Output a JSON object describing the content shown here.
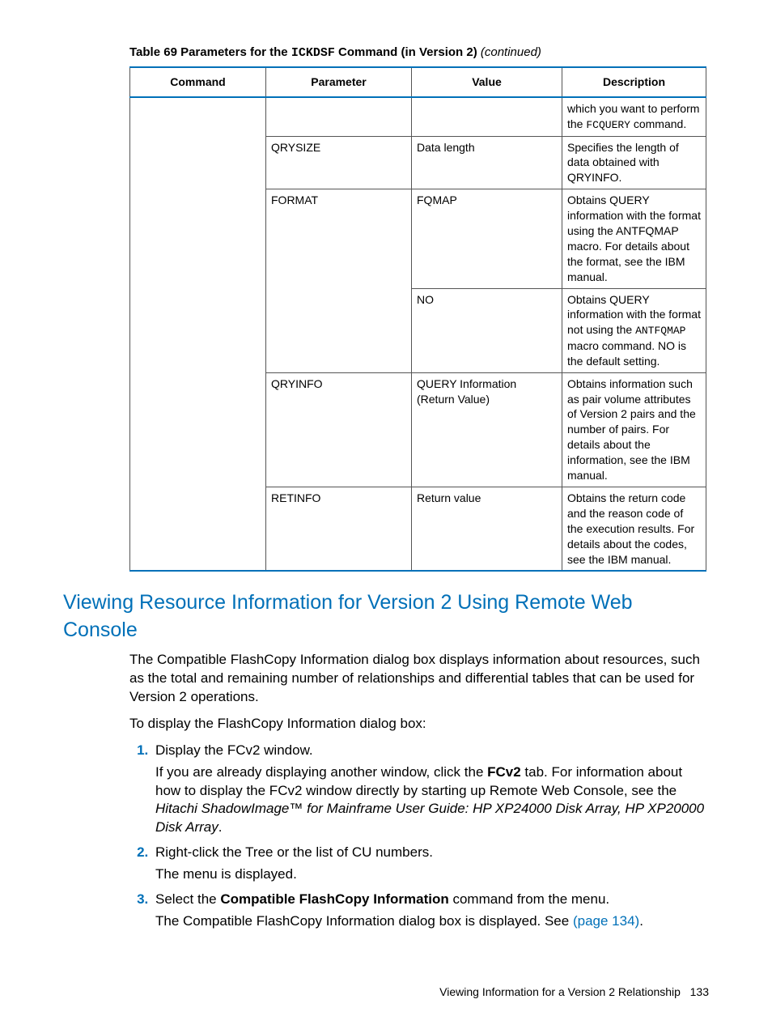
{
  "table": {
    "caption_prefix": "Table 69 Parameters for the ",
    "caption_code": "ICKDSF",
    "caption_suffix": " Command (in Version 2) ",
    "caption_tail": "(continued)",
    "headers": {
      "command": "Command",
      "parameter": "Parameter",
      "value": "Value",
      "description": "Description"
    },
    "rows": [
      {
        "command": "",
        "parameter": "",
        "value": "",
        "desc_pre": "which you want to perform the ",
        "desc_code": "FCQUERY",
        "desc_post": " command."
      },
      {
        "command": "",
        "parameter": "QRYSIZE",
        "value": "Data length",
        "desc_pre": "Specifies the length of data obtained with QRYINFO.",
        "desc_code": "",
        "desc_post": ""
      },
      {
        "command": "",
        "parameter": "FORMAT",
        "value": "FQMAP",
        "desc_pre": "Obtains QUERY information with the format using the ANTFQMAP macro. For details about the format, see the IBM manual.",
        "desc_code": "",
        "desc_post": ""
      },
      {
        "command": "",
        "parameter": "",
        "value": "NO",
        "desc_pre": "Obtains QUERY information with the format not using the ",
        "desc_code": "ANTFQMAP",
        "desc_post": " macro command. NO is the default setting."
      },
      {
        "command": "",
        "parameter": "QRYINFO",
        "value": "QUERY Information (Return Value)",
        "desc_pre": "Obtains information such as pair volume attributes of Version 2 pairs and the number of pairs. For details about the information, see the IBM manual.",
        "desc_code": "",
        "desc_post": ""
      },
      {
        "command": "",
        "parameter": "RETINFO",
        "value": "Return value",
        "desc_pre": "Obtains the return code and the reason code of the execution results. For details about the codes, see the IBM manual.",
        "desc_code": "",
        "desc_post": ""
      }
    ]
  },
  "section": {
    "title": "Viewing Resource Information for Version 2 Using Remote Web Console",
    "para1": "The Compatible FlashCopy Information dialog box displays information about resources, such as the total and remaining number of relationships and differential tables that can be used for Version 2 operations.",
    "para2": "To display the FlashCopy Information dialog box:",
    "step1_line1": "Display the FCv2 window.",
    "step1_p_pre": "If you are already displaying another window, click the ",
    "step1_p_bold": "FCv2",
    "step1_p_mid": " tab. For information about how to display the FCv2 window directly by starting up Remote Web Console, see the ",
    "step1_p_ital": "Hitachi ShadowImage™ for Mainframe User Guide: HP XP24000 Disk Array, HP XP20000 Disk Array",
    "step1_p_post": ".",
    "step2_line1": "Right-click the Tree or the list of CU numbers.",
    "step2_line2": "The menu is displayed.",
    "step3_pre": "Select the ",
    "step3_bold": "Compatible FlashCopy Information",
    "step3_post": " command from the menu.",
    "step3_line2_pre": "The Compatible FlashCopy Information dialog box is displayed. See ",
    "step3_link": "(page 134)",
    "step3_line2_post": "."
  },
  "footer": {
    "text": "Viewing Information for a Version 2 Relationship",
    "page": "133"
  }
}
